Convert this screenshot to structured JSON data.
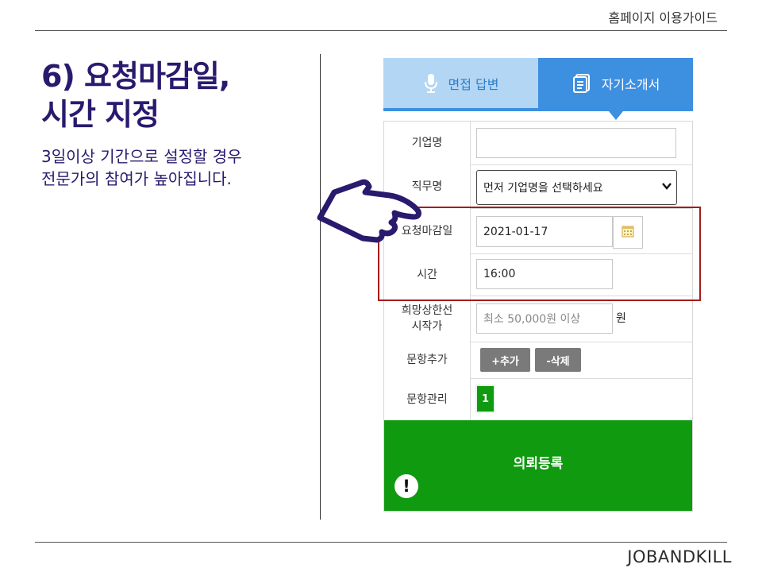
{
  "header": {
    "title": "홈페이지 이용가이드"
  },
  "footer": {
    "brand": "JOBANDKILL"
  },
  "slide": {
    "title_line1": "6) 요청마감일,",
    "title_line2": "시간 지정",
    "desc_line1": "3일이상 기간으로 설정할 경우",
    "desc_line2": "전문가의 참여가 높아집니다."
  },
  "tabs": [
    {
      "label": "면접 답변",
      "icon": "microphone-icon",
      "selected": false
    },
    {
      "label": "자기소개서",
      "icon": "document-icon",
      "selected": true
    }
  ],
  "form": {
    "company": {
      "label": "기업명",
      "value": ""
    },
    "job": {
      "label": "직무명",
      "value": "먼저 기업명을 선택하세요"
    },
    "deadline": {
      "label": "요청마감일",
      "value": "2021-01-17",
      "icon": "calendar-icon"
    },
    "time": {
      "label": "시간",
      "value": "16:00"
    },
    "price": {
      "label_line1": "희망상한선",
      "label_line2": "시작가",
      "placeholder": "최소 50,000원 이상",
      "unit": "원"
    },
    "question_add": {
      "label": "문항추가",
      "add_button": "+추가",
      "delete_button": "-삭제"
    },
    "question_manage": {
      "label": "문항관리",
      "page": "1"
    },
    "submit": {
      "label": "의뢰등록",
      "icon": "exclamation-icon"
    }
  },
  "colors": {
    "title": "#2a1a6e",
    "tab_active": "#3d8fe0",
    "tab_inactive": "#b3d6f5",
    "submit_green": "#0f9a0f",
    "highlight_red": "#a41c1c"
  }
}
